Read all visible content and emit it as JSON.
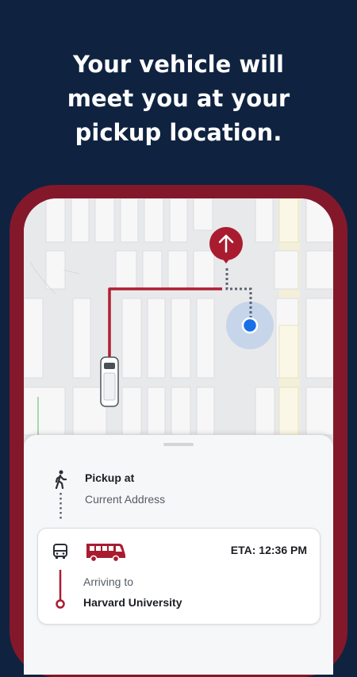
{
  "headline": {
    "line1": "Your vehicle will",
    "line2": "meet you at your",
    "line3": "pickup location."
  },
  "map": {
    "pickup_pin_icon": "arrow-up-icon",
    "vehicle_icon": "shuttle-van-icon",
    "route_color": "#b01f33",
    "user_location_color": "#1a6ee8"
  },
  "sheet": {
    "pickup_label": "Pickup at",
    "pickup_value": "Current Address",
    "walk_icon": "walking-person-icon"
  },
  "card": {
    "eta_text": "ETA: 12:36 PM",
    "arriving_label": "Arriving to",
    "destination": "Harvard University",
    "bus_icon": "bus-icon",
    "shuttle_icon": "shuttle-bus-icon"
  },
  "colors": {
    "background": "#0f2340",
    "phone_frame": "#84182b",
    "accent": "#a91c30"
  }
}
